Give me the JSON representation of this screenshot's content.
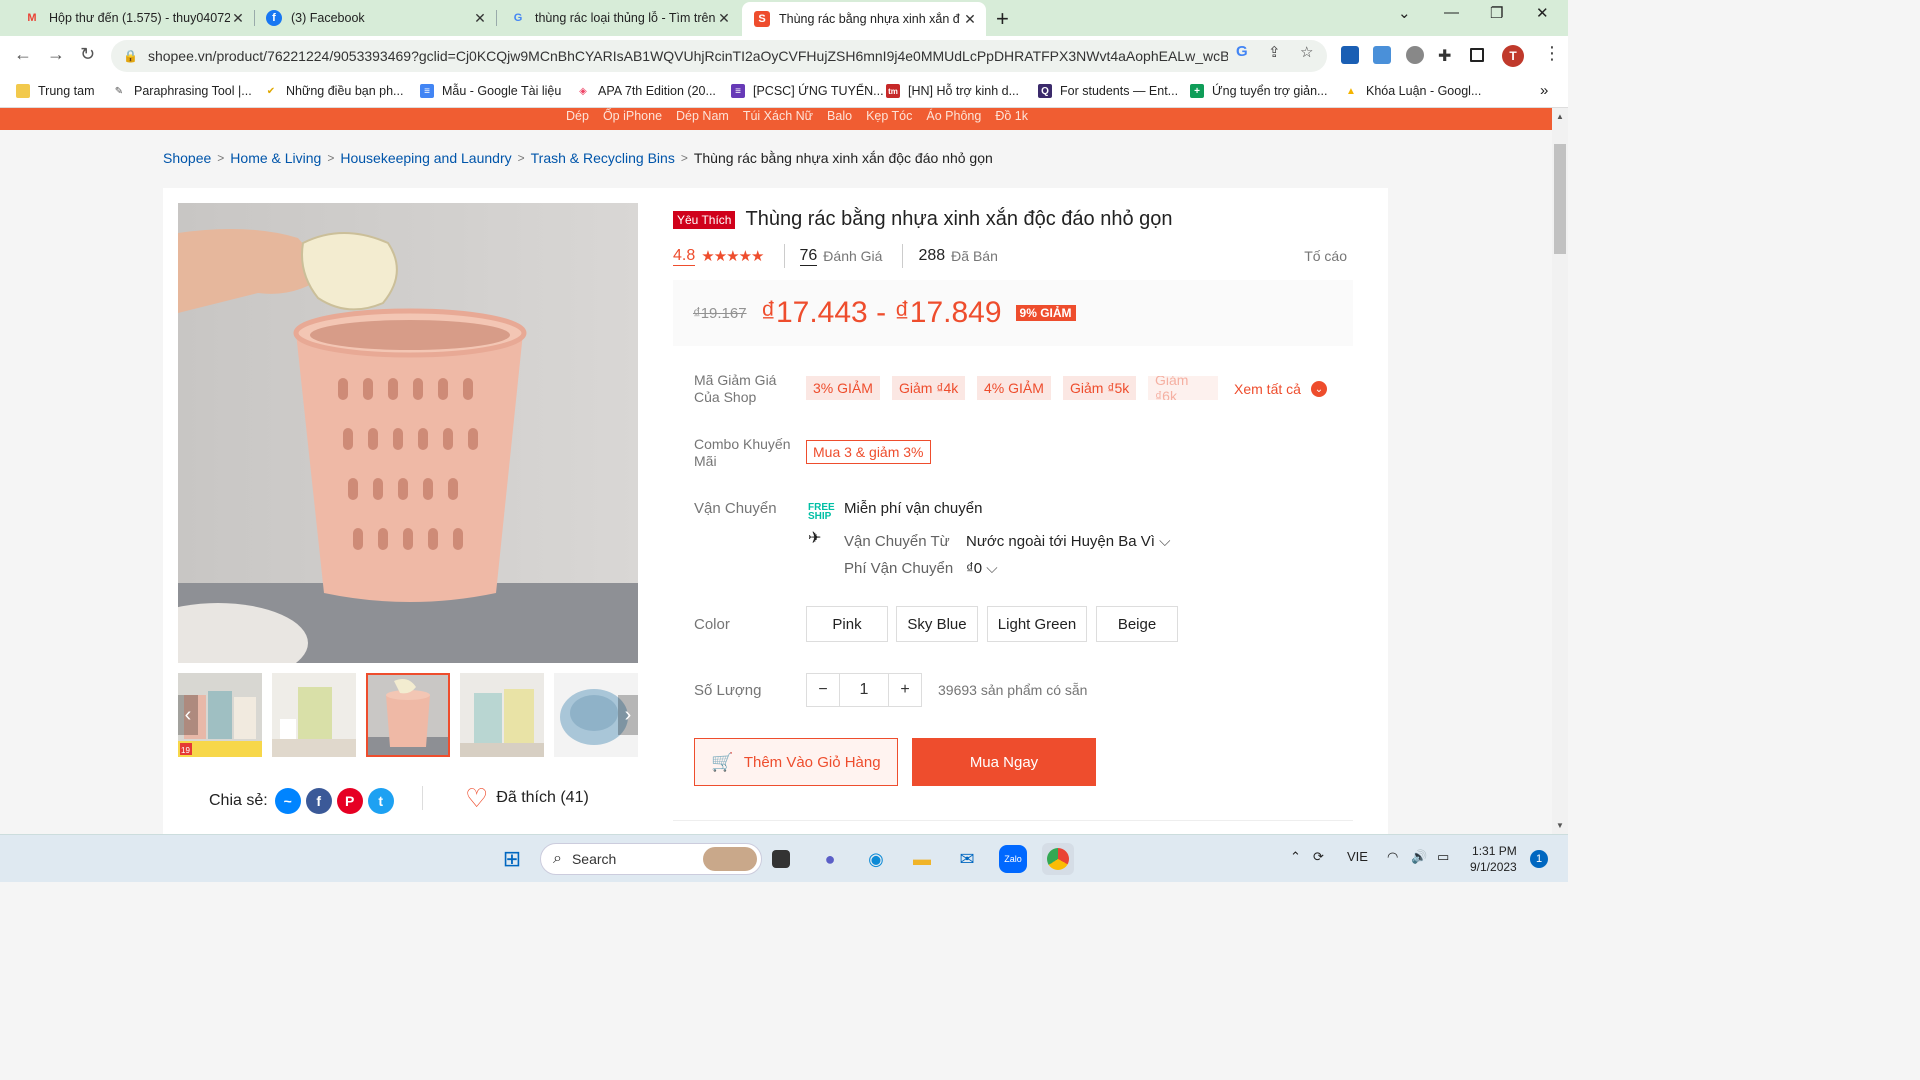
{
  "browser": {
    "tabs": [
      {
        "title": "Hộp thư đến (1.575) - thuy04072",
        "icon": "gmail-icon"
      },
      {
        "title": "(3) Facebook",
        "icon": "facebook-icon"
      },
      {
        "title": "thùng rác loại thủng lỗ - Tìm trên",
        "icon": "google-icon"
      },
      {
        "title": "Thùng rác bằng nhựa xinh xắn đ",
        "icon": "shopee-icon"
      }
    ],
    "url": "shopee.vn/product/76221224/9053393469?gclid=Cj0KCQjw9MCnBhCYARIsAB1WQVUhjRcinTI2aOyCVFHujZSH6mnI9j4e0MMUdLcPpDHRATFPX3NWvt4aAophEALw_wcB",
    "profile_initial": "T",
    "bookmarks": [
      "Trung tam",
      "Paraphrasing Tool |...",
      "Những điều bạn ph...",
      "Mẫu - Google Tài liệu",
      "APA 7th Edition (20...",
      "[PCSC] ỨNG TUYỂN...",
      "[HN] Hỗ trợ kinh d...",
      "For students — Ent...",
      "Ứng tuyển trợ giản...",
      "Khóa Luận - Googl..."
    ]
  },
  "shopee": {
    "top_links": [
      "Dép",
      "Ốp iPhone",
      "Dép Nam",
      "Túi Xách Nữ",
      "Balo",
      "Kẹp Tóc",
      "Áo Phông",
      "Đồ 1k"
    ],
    "breadcrumb": [
      "Shopee",
      "Home & Living",
      "Housekeeping and Laundry",
      "Trash & Recycling Bins"
    ],
    "breadcrumb_current": "Thùng rác bằng nhựa xinh xắn độc đáo nhỏ gọn",
    "badge": "Yêu Thích",
    "title": "Thùng rác bằng nhựa xinh xắn độc đáo nhỏ gọn",
    "rating": "4.8",
    "stars": "★★★★★",
    "reviews_count": "76",
    "reviews_label": "Đánh Giá",
    "sold_count": "288",
    "sold_label": "Đã Bán",
    "report": "Tố cáo",
    "old_price": "₫19.167",
    "price_range": "₫17.443 - ₫17.849",
    "discount": "9% GIẢM",
    "voucher_label": "Mã Giảm Giá Của Shop",
    "vouchers": [
      "3% GIẢM",
      "Giảm ₫4k",
      "4% GIẢM",
      "Giảm ₫5k",
      "Giảm ₫6k"
    ],
    "see_all": "Xem tất cả",
    "combo_label": "Combo Khuyến Mãi",
    "combo": "Mua 3 & giảm 3%",
    "shipping_label": "Vận Chuyển",
    "free_ship": "Miễn phí vận chuyển",
    "ship_from_label": "Vận Chuyển Từ",
    "ship_from": "Nước ngoài tới Huyện Ba Vì",
    "ship_fee_label": "Phí Vận Chuyển",
    "ship_fee": "₫0",
    "color_label": "Color",
    "colors": [
      "Pink",
      "Sky Blue",
      "Light Green",
      "Beige"
    ],
    "qty_label": "Số Lượng",
    "qty": "1",
    "stock": "39693 sản phẩm có sẵn",
    "add_to_cart": "Thêm Vào Giỏ Hàng",
    "buy_now": "Mua Ngay",
    "share_label": "Chia sẻ:",
    "liked": "Đã thích (41)",
    "thumbnail_badge": "19"
  },
  "taskbar": {
    "search": "Search",
    "lang": "VIE",
    "time": "1:31 PM",
    "date": "9/1/2023",
    "notifications": "1"
  }
}
